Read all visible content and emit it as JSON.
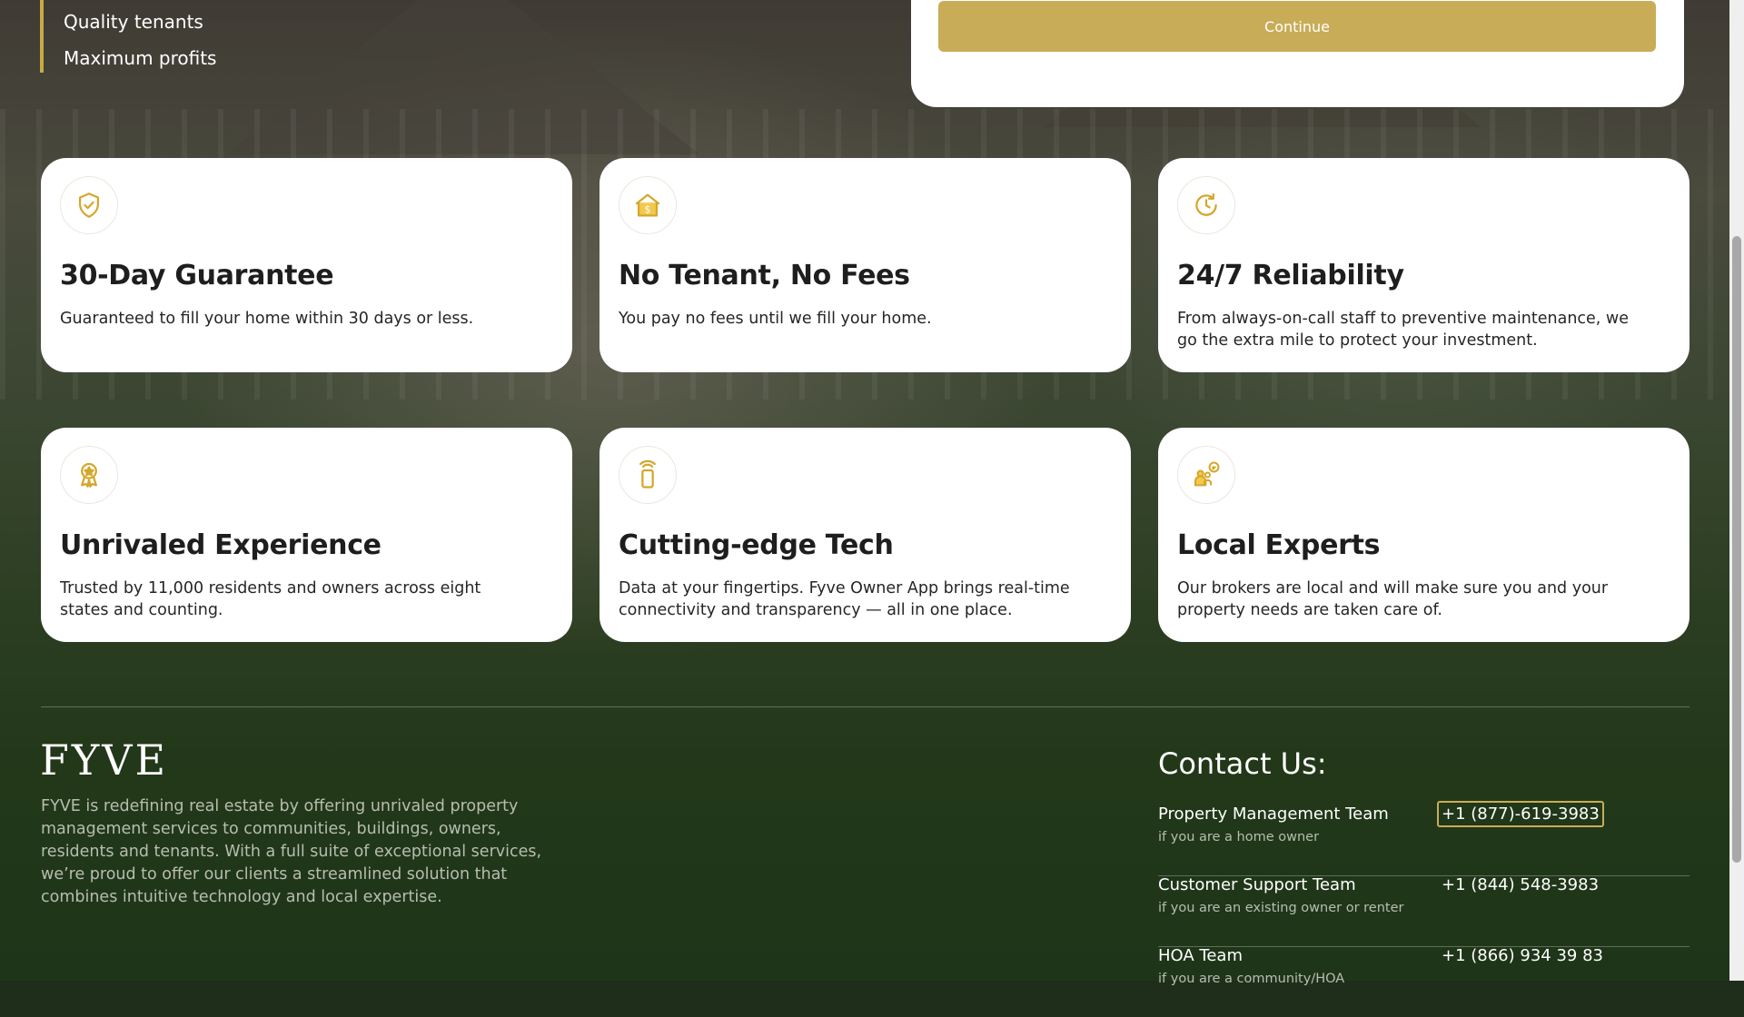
{
  "hero": {
    "bullets": [
      "Quality tenants",
      "Maximum profits"
    ]
  },
  "form": {
    "continue_label": "Continue"
  },
  "accent_color": "#c9ac58",
  "features": [
    {
      "icon": "shield-check-icon",
      "title": "30-Day Guarantee",
      "description": "Guaranteed to fill your home within 30 days or less."
    },
    {
      "icon": "house-dollar-icon",
      "title": "No Tenant, No Fees",
      "description": "You pay no fees until we fill your home."
    },
    {
      "icon": "clock-refresh-icon",
      "title": "24/7 Reliability",
      "description": "From always-on-call staff to preventive maintenance, we go the extra mile to protect your investment."
    },
    {
      "icon": "award-ribbon-icon",
      "title": "Unrivaled Experience",
      "description": "Trusted by 11,000 residents and owners across eight states and counting."
    },
    {
      "icon": "smartphone-signal-icon",
      "title": "Cutting-edge Tech",
      "description": "Data at your fingertips. Fyve Owner App brings real-time connectivity and transparency — all in one place."
    },
    {
      "icon": "people-chat-icon",
      "title": "Local Experts",
      "description": "Our brokers are local and will make sure you and your property needs are taken care of."
    }
  ],
  "footer": {
    "logo": "FYVE",
    "about": "FYVE is redefining real estate by offering unrivaled property management services to communities, buildings, owners, residents and tenants. With a full suite of exceptional services, we’re proud to offer our clients a streamlined solution that combines intuitive technology and local expertise.",
    "contact_title": "Contact Us:",
    "contacts": [
      {
        "team": "Property Management Team",
        "sub": "if you are a home owner",
        "phone": "+1 (877)-619-3983"
      },
      {
        "team": "Customer Support Team",
        "sub": "if you are an existing owner or renter",
        "phone": "+1 (844) 548-3983"
      },
      {
        "team": "HOA Team",
        "sub": "if you are a community/HOA",
        "phone": "+1 (866) 934 39 83"
      }
    ]
  }
}
